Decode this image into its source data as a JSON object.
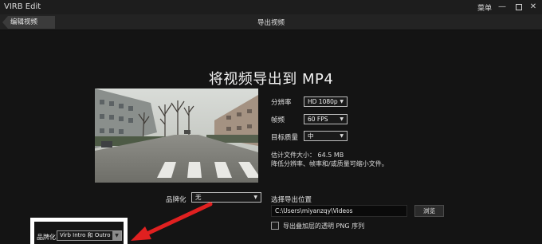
{
  "window": {
    "title": "VIRB Edit",
    "menu": "菜单"
  },
  "nav": {
    "back_label": "编辑视频",
    "heading": "导出视频"
  },
  "main": {
    "title": "将视频导出到 MP4",
    "resolution": {
      "label": "分辨率",
      "value": "HD 1080p"
    },
    "fps": {
      "label": "帧频",
      "value": "60 FPS"
    },
    "quality": {
      "label": "目标质量",
      "value": "中"
    },
    "estimate": "估计文件大小： 64.5 MB",
    "hint": "降低分辨率、帧率和/或质量可缩小文件。",
    "branding": {
      "label": "品牌化",
      "value": "无"
    },
    "save": {
      "label": "选择导出位置",
      "path": "C:\\Users\\miyanzqy\\Videos",
      "browse": "浏览",
      "overlay_checkbox": "导出叠加层的透明 PNG 序列"
    },
    "highlight": {
      "label": "品牌化",
      "value": "Virb Intro 和 Outro"
    }
  },
  "colors": {
    "background": "#141414",
    "titlebar": "#1d1d1d",
    "navbar": "#232323",
    "arrow": "#e02020",
    "highlight_border": "#ffffff"
  },
  "icons": {
    "preview": "video-preview-thumbnail",
    "arrow": "red-pointer-arrow"
  }
}
